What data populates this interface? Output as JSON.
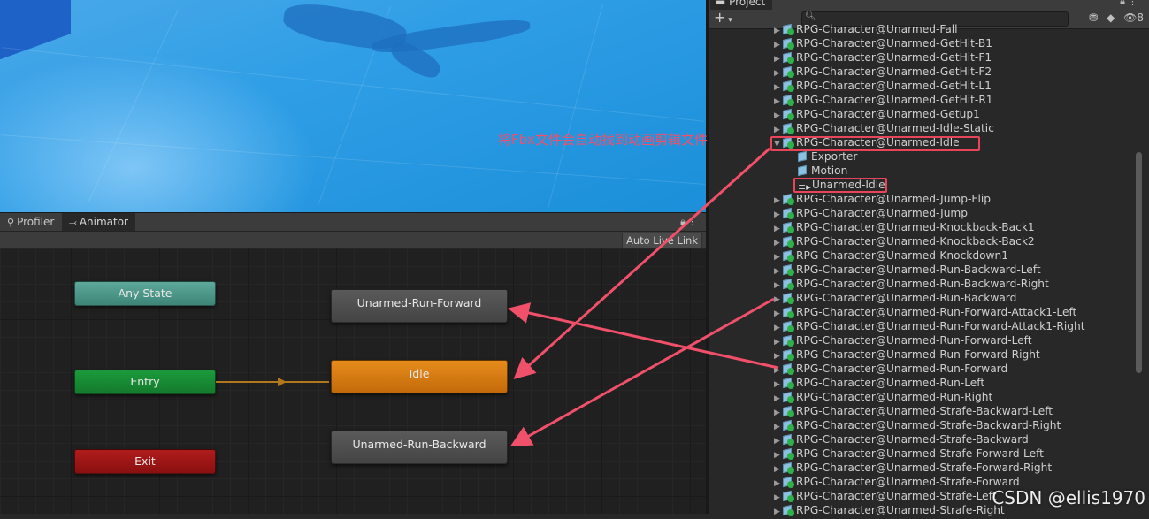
{
  "scene": {},
  "animator": {
    "tabs": [
      {
        "label": "Profiler",
        "icon": "profiler-icon"
      },
      {
        "label": "Animator",
        "icon": "animator-icon"
      }
    ],
    "auto_live_link": "Auto Live Link",
    "nodes": {
      "any_state": "Any State",
      "entry": "Entry",
      "exit": "Exit",
      "run_forward": "Unarmed-Run-Forward",
      "idle": "Idle",
      "run_backward": "Unarmed-Run-Backward"
    }
  },
  "project": {
    "tab_label": "Project",
    "add_button": "+",
    "hidden_count": "8",
    "items": [
      {
        "label": "RPG-Character@Unarmed-Fall",
        "type": "model",
        "expanded": false
      },
      {
        "label": "RPG-Character@Unarmed-GetHit-B1",
        "type": "model",
        "expanded": false
      },
      {
        "label": "RPG-Character@Unarmed-GetHit-F1",
        "type": "model",
        "expanded": false
      },
      {
        "label": "RPG-Character@Unarmed-GetHit-F2",
        "type": "model",
        "expanded": false
      },
      {
        "label": "RPG-Character@Unarmed-GetHit-L1",
        "type": "model",
        "expanded": false
      },
      {
        "label": "RPG-Character@Unarmed-GetHit-R1",
        "type": "model",
        "expanded": false
      },
      {
        "label": "RPG-Character@Unarmed-Getup1",
        "type": "model",
        "expanded": false
      },
      {
        "label": "RPG-Character@Unarmed-Idle-Static",
        "type": "model",
        "expanded": false
      },
      {
        "label": "RPG-Character@Unarmed-Idle",
        "type": "model",
        "expanded": true
      },
      {
        "label": "Exporter",
        "type": "child-mesh"
      },
      {
        "label": "Motion",
        "type": "child-mesh"
      },
      {
        "label": "Unarmed-Idle",
        "type": "child-clip"
      },
      {
        "label": "RPG-Character@Unarmed-Jump-Flip",
        "type": "model",
        "expanded": false
      },
      {
        "label": "RPG-Character@Unarmed-Jump",
        "type": "model",
        "expanded": false
      },
      {
        "label": "RPG-Character@Unarmed-Knockback-Back1",
        "type": "model",
        "expanded": false
      },
      {
        "label": "RPG-Character@Unarmed-Knockback-Back2",
        "type": "model",
        "expanded": false
      },
      {
        "label": "RPG-Character@Unarmed-Knockdown1",
        "type": "model",
        "expanded": false
      },
      {
        "label": "RPG-Character@Unarmed-Run-Backward-Left",
        "type": "model",
        "expanded": false
      },
      {
        "label": "RPG-Character@Unarmed-Run-Backward-Right",
        "type": "model",
        "expanded": false
      },
      {
        "label": "RPG-Character@Unarmed-Run-Backward",
        "type": "model",
        "expanded": false
      },
      {
        "label": "RPG-Character@Unarmed-Run-Forward-Attack1-Left",
        "type": "model",
        "expanded": false
      },
      {
        "label": "RPG-Character@Unarmed-Run-Forward-Attack1-Right",
        "type": "model",
        "expanded": false
      },
      {
        "label": "RPG-Character@Unarmed-Run-Forward-Left",
        "type": "model",
        "expanded": false
      },
      {
        "label": "RPG-Character@Unarmed-Run-Forward-Right",
        "type": "model",
        "expanded": false
      },
      {
        "label": "RPG-Character@Unarmed-Run-Forward",
        "type": "model",
        "expanded": false
      },
      {
        "label": "RPG-Character@Unarmed-Run-Left",
        "type": "model",
        "expanded": false
      },
      {
        "label": "RPG-Character@Unarmed-Run-Right",
        "type": "model",
        "expanded": false
      },
      {
        "label": "RPG-Character@Unarmed-Strafe-Backward-Left",
        "type": "model",
        "expanded": false
      },
      {
        "label": "RPG-Character@Unarmed-Strafe-Backward-Right",
        "type": "model",
        "expanded": false
      },
      {
        "label": "RPG-Character@Unarmed-Strafe-Backward",
        "type": "model",
        "expanded": false
      },
      {
        "label": "RPG-Character@Unarmed-Strafe-Forward-Left",
        "type": "model",
        "expanded": false
      },
      {
        "label": "RPG-Character@Unarmed-Strafe-Forward-Right",
        "type": "model",
        "expanded": false
      },
      {
        "label": "RPG-Character@Unarmed-Strafe-Forward",
        "type": "model",
        "expanded": false
      },
      {
        "label": "RPG-Character@Unarmed-Strafe-Left",
        "type": "model",
        "expanded": false
      },
      {
        "label": "RPG-Character@Unarmed-Strafe-Right",
        "type": "model",
        "expanded": false
      }
    ]
  },
  "annotation": {
    "text": "将Fbx文件会自动找到动画剪辑文件",
    "color": "#f0506a"
  },
  "watermark": "CSDN @ellis1970"
}
